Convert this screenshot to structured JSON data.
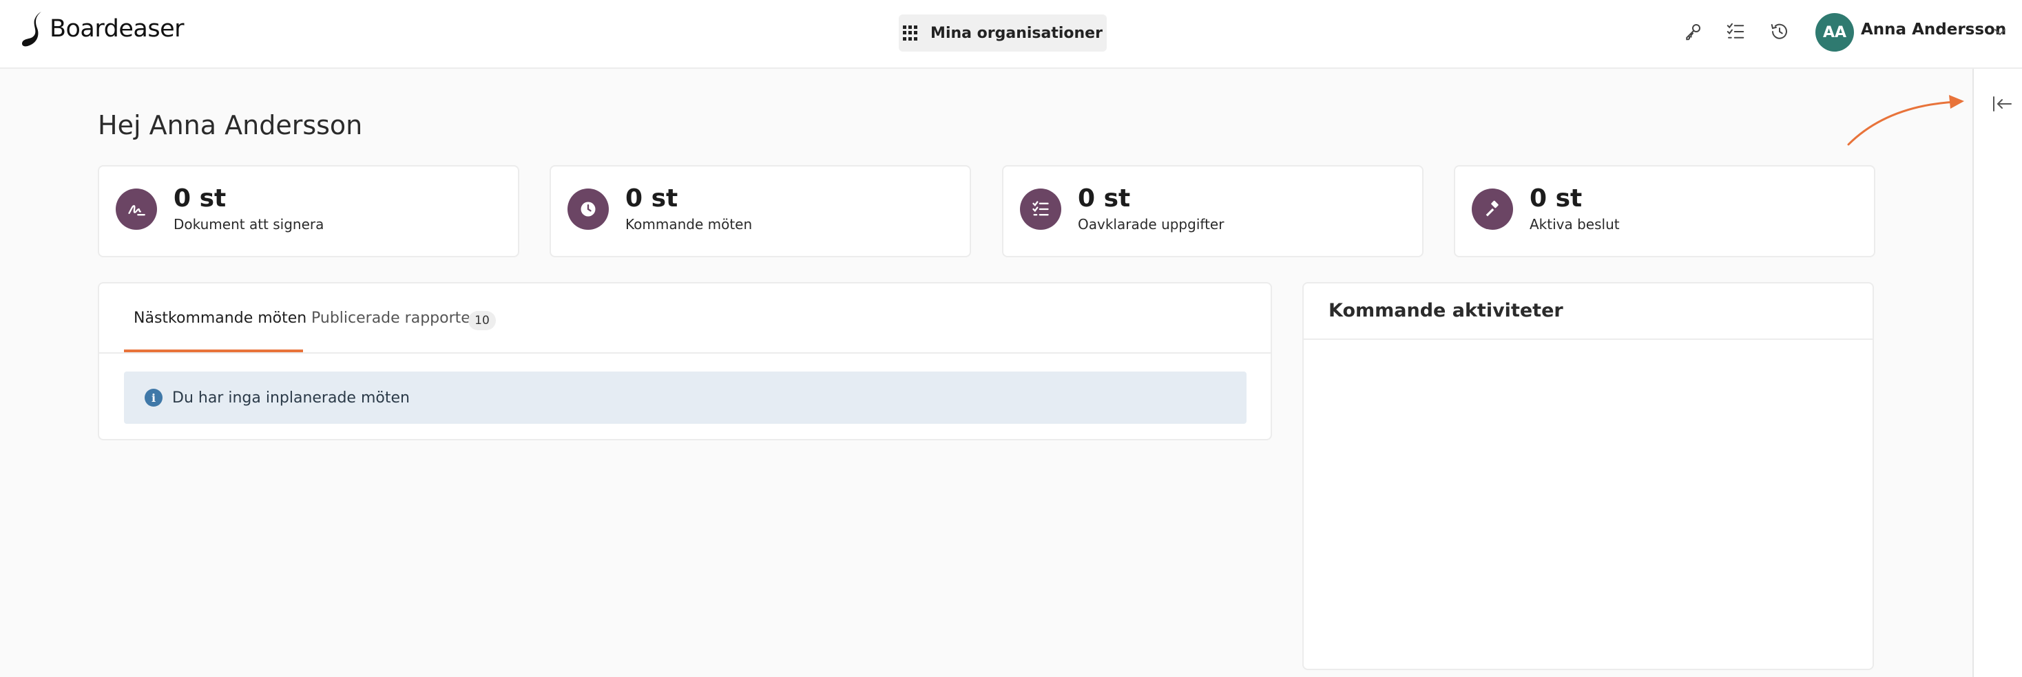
{
  "header": {
    "logo_text": "Boardeaser",
    "org_button_label": "Mina organisationer",
    "icons": [
      "key-icon",
      "tasks-icon",
      "history-icon"
    ],
    "user": {
      "initials": "AA",
      "name": "Anna Andersson"
    }
  },
  "greeting": "Hej Anna Andersson",
  "stats": [
    {
      "value": "0 st",
      "label": "Dokument att signera",
      "icon": "signature-icon"
    },
    {
      "value": "0 st",
      "label": "Kommande möten",
      "icon": "clock-icon"
    },
    {
      "value": "0 st",
      "label": "Oavklarade uppgifter",
      "icon": "checklist-icon"
    },
    {
      "value": "0 st",
      "label": "Aktiva beslut",
      "icon": "gavel-icon"
    }
  ],
  "tabs": [
    {
      "label": "Nästkommande möten",
      "active": true
    },
    {
      "label": "Publicerade rapporter",
      "badge": "10",
      "active": false
    }
  ],
  "alert": {
    "message": "Du har inga inplanerade möten"
  },
  "activities": {
    "title": "Kommande aktiviteter"
  },
  "colors": {
    "accent": "#e8733a",
    "brand": "#6b4564",
    "avatar": "#2f7a70",
    "info": "#3f78a8"
  }
}
